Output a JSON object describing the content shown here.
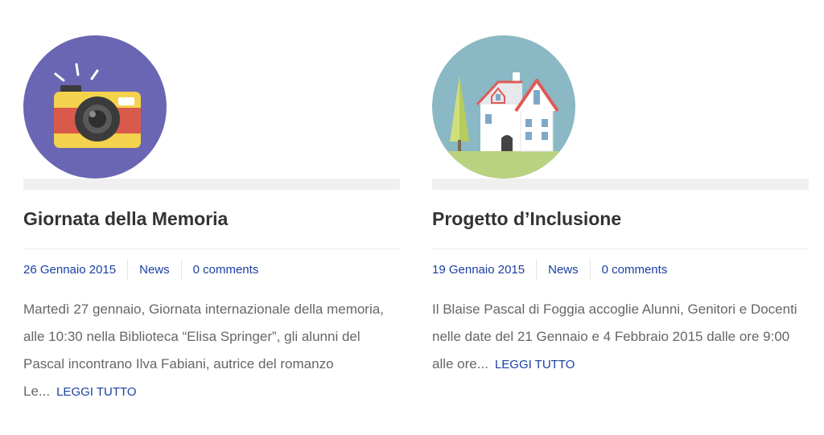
{
  "posts": [
    {
      "title": "Giornata della Memoria",
      "date": "26 Gennaio 2015",
      "category": "News",
      "comments": "0 comments",
      "excerpt": "Martedì 27 gennaio, Giornata internazionale della memoria, alle 10:30 nella Biblioteca “Elisa Springer”, gli alunni del Pascal incontrano Ilva Fabiani, autrice del romanzo Le...",
      "read_more": "LEGGI TUTTO",
      "thumbnail_icon": "camera-icon",
      "thumbnail_bg": "#6a66b3"
    },
    {
      "title": "Progetto d’Inclusione",
      "date": "19 Gennaio 2015",
      "category": "News",
      "comments": "0 comments",
      "excerpt": "Il Blaise Pascal di Foggia accoglie Alunni, Genitori e Docenti nelle date del 21 Gennaio e 4 Febbraio 2015 dalle ore 9:00 alle ore...",
      "read_more": "LEGGI TUTTO",
      "thumbnail_icon": "house-icon",
      "thumbnail_bg": "#8ab8c4"
    }
  ],
  "colors": {
    "link": "#1a3fa0",
    "title": "#333333",
    "body_text": "#666666",
    "bar": "#f0f0f0"
  }
}
